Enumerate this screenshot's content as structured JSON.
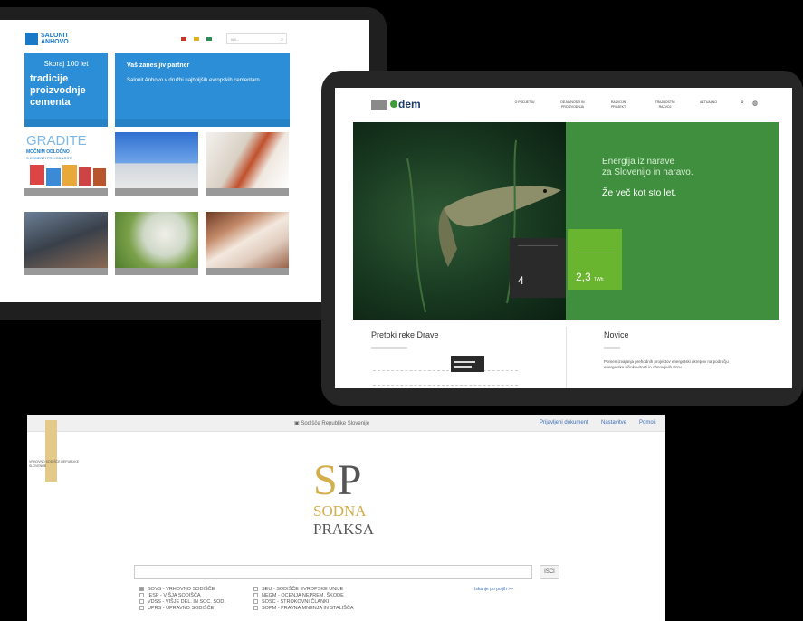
{
  "salonit": {
    "logo_line1": "SALONIT",
    "logo_line2": "ANHOVO",
    "search_placeholder": "Išči...",
    "flag_colors": [
      "#c0392b",
      "#e0b020",
      "#2e8b57"
    ],
    "box1_small": "Skoraj 100 let",
    "box1_lines": [
      "tradicije",
      "proizvodnje",
      "cementa"
    ],
    "box2_title": "Vaš zanesljiv partner",
    "box2_text": "Salonit Anhovo v družbi najboljših evropskih cementarn",
    "tiles": [
      {
        "title_line1": "GRADITE",
        "title_line2": "MOČNIM ODLOČNO",
        "title_line3": "S CEMENTI PRIHODNOSTI"
      },
      {},
      {},
      {},
      {},
      {}
    ]
  },
  "dem": {
    "logo": "dem",
    "nav": [
      "O PODJETJU",
      "DEJAVNOSTI IN PROIZVODNJA",
      "RAZVOJNI PROJEKTI",
      "TRAJNOSTNI RAZVOJ",
      "AKTUALNO"
    ],
    "hero_line1": "Energija iz narave",
    "hero_line2": "za Slovenijo in naravo.",
    "hero_line3": "Že več kot sto let.",
    "dark_card_value": "4",
    "green_card_value": "2,3",
    "green_card_unit": "TWh",
    "pretoki_title": "Pretoki reke Drave",
    "novice_title": "Novice",
    "novice_text": "Pomen izvajanja prehodnih projektov energetski ukrepov na področju energetske učinkovitosti in obnovljivih virov..."
  },
  "sodna": {
    "top_center": "Sodišče Republike Slovenije",
    "top_links": [
      "Prijavljeni dokument",
      "Nastavitve",
      "Pomoč"
    ],
    "emblem_text": "VRHOVNO SODIŠČE REPUBLIKE SLOVENIJE",
    "sp": "SP",
    "sodna": "SODNA",
    "praksa": "PRAKSA",
    "go": "ISČI",
    "advanced": "Iskanje po poljih >>",
    "checks_left": [
      "SOVS - VRHOVNO SODIŠČE",
      "IESP - VIŠJA SODIŠČA",
      "VDSS - VIŠJE DEL. IN SOC. SOD.",
      "UPRS - UPRAVNO SODIŠČE"
    ],
    "checks_right": [
      "SEU - SODIŠČE EVROPSKE UNIJE",
      "NEGM - OCENJA NEPREM. ŠKODE",
      "SOSC - STROKOVNI ČLANKI",
      "SOPM - PRAVNA MNENJA IN STALIŠČA"
    ]
  }
}
